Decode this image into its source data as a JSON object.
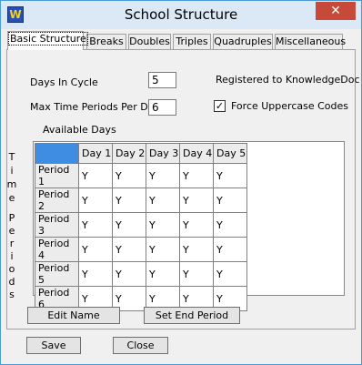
{
  "window": {
    "title": "School Structure",
    "close_glyph": "✕",
    "app_icon_glyph": "W"
  },
  "tabs": [
    {
      "label": "Basic Structure",
      "active": true
    },
    {
      "label": "Breaks"
    },
    {
      "label": "Doubles"
    },
    {
      "label": "Triples"
    },
    {
      "label": "Quadruples"
    },
    {
      "label": "Miscellaneous"
    }
  ],
  "basic": {
    "days_in_cycle_label": "Days In Cycle",
    "days_in_cycle_value": "5",
    "max_periods_label": "Max Time Periods Per Day",
    "max_periods_value": "6",
    "registered_text": "Registered to KnowledgeDoc",
    "force_uppercase_label": "Force Uppercase Codes",
    "force_uppercase_checked": true,
    "check_glyph": "✓",
    "available_days_label": "Available Days",
    "vertical_label_top": [
      "T",
      "i",
      "m",
      "e"
    ],
    "vertical_label_bottom": [
      "P",
      "e",
      "r",
      "i",
      "o",
      "d",
      "s"
    ]
  },
  "grid": {
    "columns": [
      "Day 1",
      "Day 2",
      "Day 3",
      "Day 4",
      "Day 5"
    ],
    "rows": [
      {
        "label": "Period 1",
        "cells": [
          "Y",
          "Y",
          "Y",
          "Y",
          "Y"
        ]
      },
      {
        "label": "Period 2",
        "cells": [
          "Y",
          "Y",
          "Y",
          "Y",
          "Y"
        ]
      },
      {
        "label": "Period 3",
        "cells": [
          "Y",
          "Y",
          "Y",
          "Y",
          "Y"
        ]
      },
      {
        "label": "Period 4",
        "cells": [
          "Y",
          "Y",
          "Y",
          "Y",
          "Y"
        ]
      },
      {
        "label": "Period 5",
        "cells": [
          "Y",
          "Y",
          "Y",
          "Y",
          "Y"
        ]
      },
      {
        "label": "Period 6",
        "cells": [
          "Y",
          "Y",
          "Y",
          "Y",
          "Y"
        ]
      }
    ]
  },
  "buttons": {
    "edit_name": "Edit Name",
    "set_end_period": "Set End Period",
    "save": "Save",
    "close": "Close"
  },
  "colors": {
    "corner_cell": "#3f8ce3",
    "titlebar": "#dbe8f5",
    "close_button": "#c7493a"
  }
}
